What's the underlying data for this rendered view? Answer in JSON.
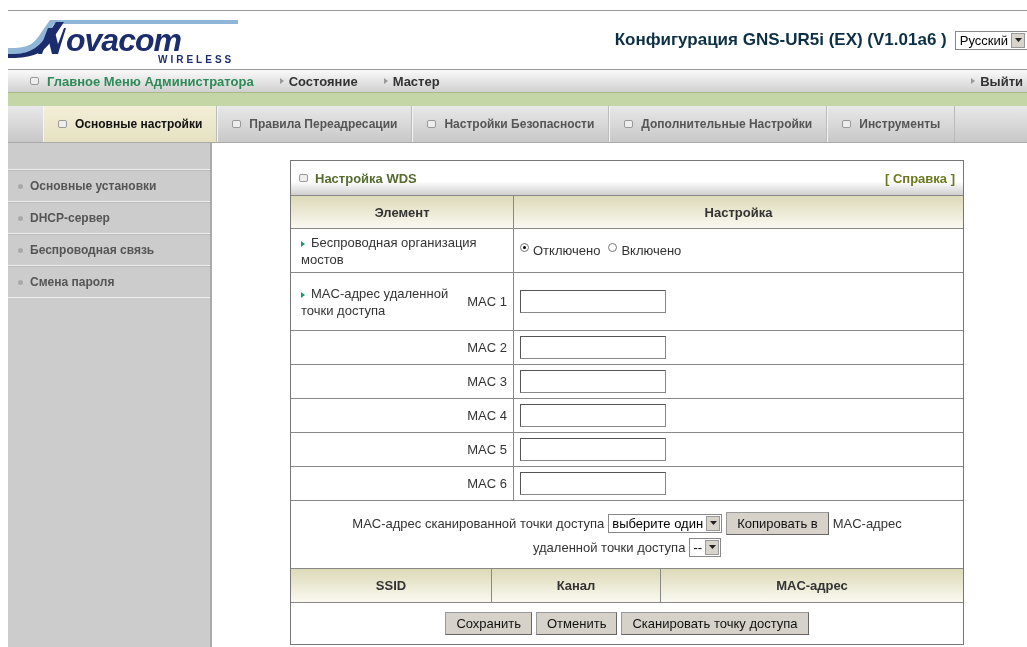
{
  "logo": {
    "name": "ovacom",
    "tagline": "WIRELESS"
  },
  "header": {
    "title": "Конфигурация GNS-UR5i (EX) (V1.01a6 )",
    "language": "Русский"
  },
  "nav": {
    "items": [
      {
        "label": "Главное Меню Администратора",
        "kind": "main"
      },
      {
        "label": "Состояние",
        "kind": "link"
      },
      {
        "label": "Мастер",
        "kind": "link"
      }
    ],
    "logout": "Выйти"
  },
  "tabs": [
    {
      "label": "Основные настройки",
      "selected": true
    },
    {
      "label": "Правила Переадресации",
      "selected": false
    },
    {
      "label": "Настройки Безопасности",
      "selected": false
    },
    {
      "label": "Дополнительные Настройки",
      "selected": false
    },
    {
      "label": "Инструменты",
      "selected": false
    }
  ],
  "sidebar": {
    "items": [
      {
        "label": "Основные установки"
      },
      {
        "label": "DHCP-сервер"
      },
      {
        "label": "Беспроводная связь"
      },
      {
        "label": "Смена пароля"
      }
    ]
  },
  "panel": {
    "title": "Настройка WDS",
    "help": "[ Справка ]",
    "columns": [
      "Элемент",
      "Настройка"
    ],
    "bridging": {
      "label": "Беспроводная организация мостов",
      "options": [
        {
          "label": "Отключено",
          "selected": true
        },
        {
          "label": "Включено",
          "selected": false
        }
      ]
    },
    "mac_label": "MAC-адрес удаленной точки доступа",
    "macs": [
      {
        "label": "MAC 1"
      },
      {
        "label": "MAC 2"
      },
      {
        "label": "MAC 3"
      },
      {
        "label": "MAC 4"
      },
      {
        "label": "MAC 5"
      },
      {
        "label": "MAC 6"
      }
    ],
    "scan": {
      "text_1": "MAC-адрес сканированной точки доступа",
      "select_1": "выберите один",
      "copy_button": "Копировать в",
      "text_2": "MAC-адрес",
      "text_3": "удаленной точки доступа",
      "select_2": "--"
    },
    "scan_columns": [
      "SSID",
      "Канал",
      "MAC-адрес"
    ],
    "buttons": [
      "Сохранить",
      "Отменить",
      "Сканировать точку доступа"
    ]
  }
}
